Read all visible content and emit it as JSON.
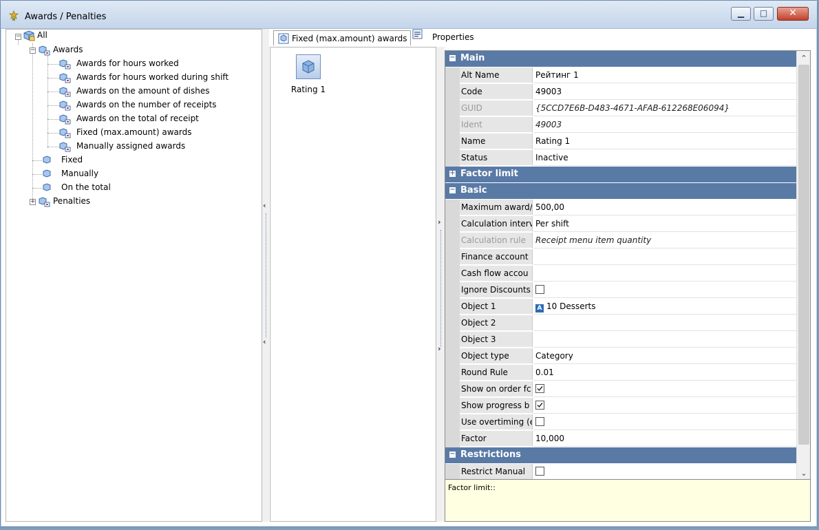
{
  "window": {
    "title": "Awards / Penalties"
  },
  "tree": {
    "root": "All",
    "awards": "Awards",
    "award_children": [
      "Awards for hours worked",
      "Awards for hours worked during shift",
      "Awards on the amount of dishes",
      "Awards on the number of receipts",
      "Awards on the total of receipt",
      "Fixed (max.amount) awards",
      "Manually assigned awards"
    ],
    "siblings": [
      "Fixed",
      "Manually",
      "On the total"
    ],
    "penalties": "Penalties"
  },
  "tabs": {
    "items": "Fixed (max.amount) awards",
    "properties": "Properties"
  },
  "items": [
    {
      "label": "Rating 1"
    }
  ],
  "properties": {
    "main": {
      "title": "Main",
      "rows": [
        {
          "name": "Alt Name",
          "value": "Рейтинг 1"
        },
        {
          "name": "Code",
          "value": "49003"
        },
        {
          "name": "GUID",
          "value": "{5CCD7E6B-D483-4671-AFAB-612268E06094}"
        },
        {
          "name": "Ident",
          "value": "49003"
        },
        {
          "name": "Name",
          "value": "Rating 1"
        },
        {
          "name": "Status",
          "value": "Inactive"
        }
      ]
    },
    "factor_limit": {
      "title": "Factor limit"
    },
    "basic": {
      "title": "Basic",
      "rows": [
        {
          "name": "Maximum award/",
          "value": "500,00"
        },
        {
          "name": "Calculation interv",
          "value": "Per shift"
        },
        {
          "name": "Calculation rule",
          "value": "Receipt menu item quantity"
        },
        {
          "name": "Finance account",
          "value": ""
        },
        {
          "name": "Cash flow accou",
          "value": ""
        },
        {
          "name": "Ignore Discounts",
          "value": ""
        },
        {
          "name": "Object 1",
          "value": "10 Desserts"
        },
        {
          "name": "Object 2",
          "value": ""
        },
        {
          "name": "Object 3",
          "value": ""
        },
        {
          "name": "Object type",
          "value": "Category"
        },
        {
          "name": "Round Rule",
          "value": "0.01"
        },
        {
          "name": "Show on order fc",
          "value": ""
        },
        {
          "name": "Show progress b",
          "value": ""
        },
        {
          "name": "Use overtiming (e",
          "value": ""
        },
        {
          "name": "Factor",
          "value": "10,000"
        }
      ],
      "checkboxes": {
        "ignore_discounts": false,
        "show_on_order": true,
        "show_progress": true,
        "use_overtiming": false
      },
      "object_badge": "A"
    },
    "restrictions": {
      "title": "Restrictions",
      "rows": [
        {
          "name": "Restrict Manual",
          "value": ""
        }
      ],
      "checkboxes": {
        "restrict_manual": false
      }
    }
  },
  "help": {
    "text": "Factor limit::"
  },
  "colors": {
    "category_bar": "#5a7aa6",
    "help_bg": "#ffffe1",
    "close_button": "#c2412c"
  }
}
